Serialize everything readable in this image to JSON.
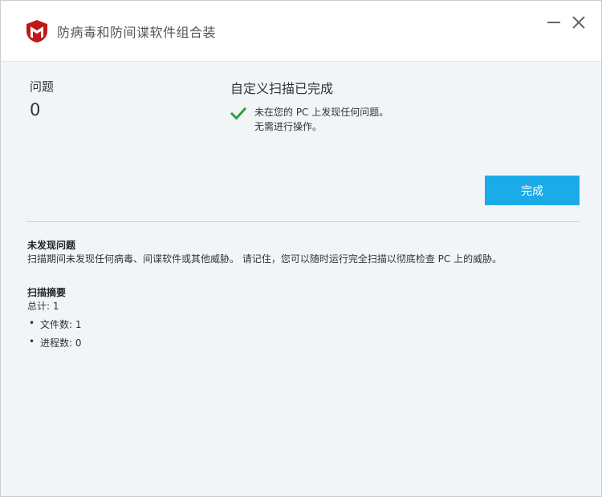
{
  "window": {
    "title": "防病毒和防间谍软件组合装"
  },
  "summary": {
    "issues_label": "问题",
    "issues_count": "0",
    "scan_status": "自定义扫描已完成",
    "result_line1": "未在您的 PC 上发现任何问题。",
    "result_line2": "无需进行操作。",
    "done_button": "完成"
  },
  "details": {
    "no_issues_title": "未发现问题",
    "no_issues_text": "扫描期间未发现任何病毒、间谍软件或其他威胁。 请记住，您可以随时运行完全扫描以彻底检查 PC 上的威胁。",
    "scan_summary_title": "扫描摘要",
    "total": "总计: 1",
    "bullets": [
      "文件数: 1",
      "进程数: 0"
    ]
  },
  "colors": {
    "accent": "#1aabe8",
    "brand": "#c01818",
    "check": "#2ea043"
  },
  "icons": {
    "logo": "mcafee-shield-icon",
    "minimize": "minimize-icon",
    "close": "close-icon",
    "status": "checkmark-icon"
  }
}
